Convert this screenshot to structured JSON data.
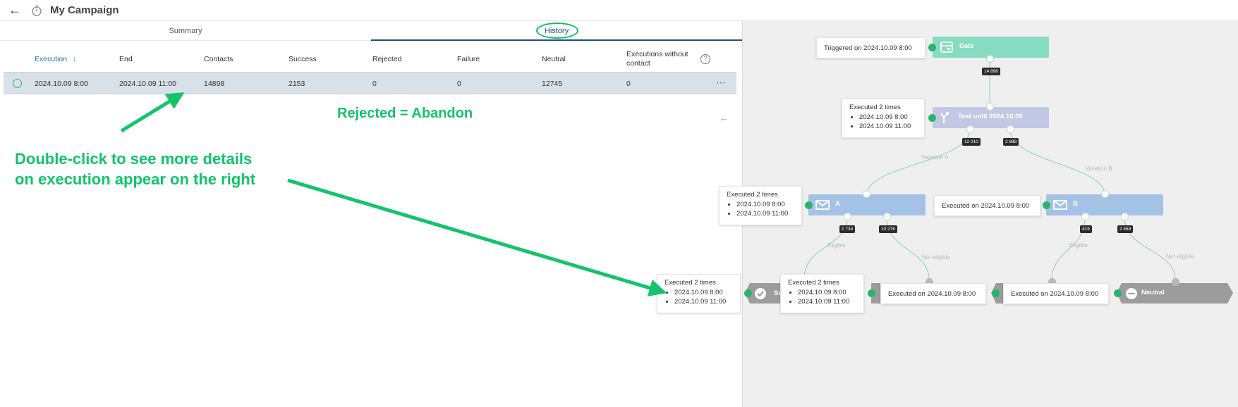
{
  "header": {
    "title": "My Campaign"
  },
  "tabs": [
    {
      "label": "Summary"
    },
    {
      "label": "History"
    }
  ],
  "table": {
    "columns": [
      "Execution",
      "End",
      "Contacts",
      "Success",
      "Rejected",
      "Failure",
      "Neutral",
      "Executions without contact"
    ],
    "rows": [
      {
        "execution": "2024.10.09 8:00",
        "end": "2024.10.09 11:00",
        "contacts": "14898",
        "success": "2153",
        "rejected": "0",
        "failure": "0",
        "neutral": "12745",
        "without_contact": "0"
      }
    ]
  },
  "annotations": {
    "rejected_note": "Rejected = Abandon",
    "double_click_line1": "Double-click to see more details",
    "double_click_line2": "on execution appear on the right"
  },
  "flow": {
    "nodes": {
      "date": "Date",
      "test": "Test until 2024.10.09",
      "a": "A",
      "b": "B",
      "success": "Su",
      "neutral": "Neutral"
    },
    "info": {
      "triggered": "Triggered on 2024.10.09 8:00",
      "exec2": "Executed 2 times",
      "t1": "2024.10.09 8:00",
      "t2": "2024.10.09 11:00",
      "executed_on": "Executed on 2024.10.09 8:00"
    },
    "badges": {
      "date_out": "14 898",
      "test_a": "12 010",
      "test_b": "2 888",
      "a_eligible": "1 734",
      "a_not": "10 276",
      "b_eligible": "419",
      "b_not": "2 469"
    },
    "branch_labels": {
      "variation_a": "Variation A",
      "variation_b": "Variation B",
      "eligible": "Eligible",
      "not_eligible": "Not eligible"
    }
  },
  "colors": {
    "accent": "#1f4e79",
    "annotation_green": "#12c46a",
    "date_node": "#86dcc0",
    "test_node": "#c2c7e4",
    "message_node": "#a3c2e6",
    "end_node": "#9c9c9c",
    "row_bg": "#d8e0e8"
  }
}
